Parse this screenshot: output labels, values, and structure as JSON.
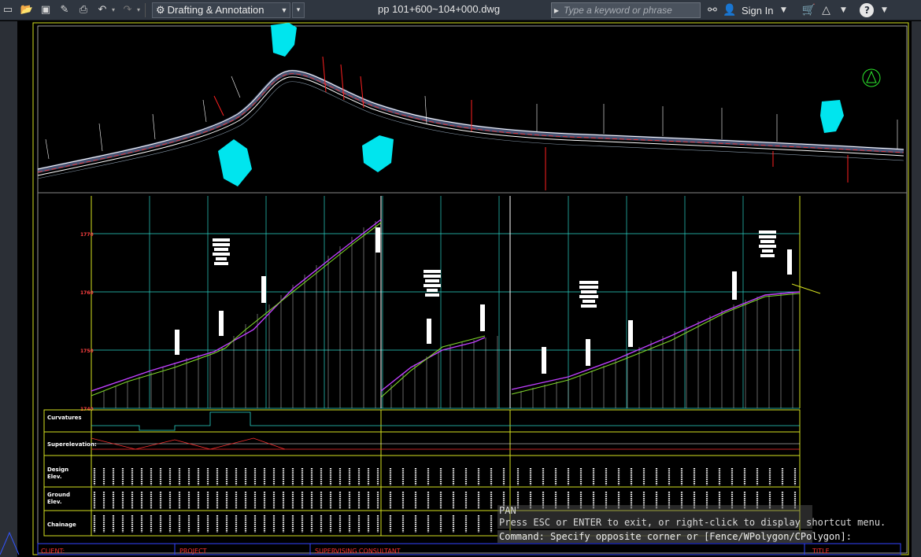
{
  "toolbar": {
    "workspace_label": "Drafting & Annotation",
    "document_title": "pp 101+600~104+000.dwg",
    "search_placeholder": "Type a keyword or phrase",
    "signin_label": "Sign In",
    "help_label": "?"
  },
  "icons": {
    "new": "new-icon",
    "open": "open-icon",
    "save": "save-icon",
    "saveas": "saveas-icon",
    "print": "print-icon",
    "undo": "undo-icon",
    "redo": "redo-icon",
    "gear": "gear-icon",
    "binoculars": "binoculars-icon",
    "user": "user-icon",
    "cart": "cart-icon",
    "a360": "a360-icon"
  },
  "profile": {
    "row_labels": {
      "curvatures": "Curvatures",
      "superelevation": "Superelevation:",
      "design_elev": "Design\nElev.",
      "ground_elev": "Ground\nElev.",
      "chainage": "Chainage"
    }
  },
  "title_block": {
    "client_label": "CLIENT:",
    "project_label": "PROJECT",
    "consultant_label": "SUPERVISING CONSULTANT",
    "title_label": "TITLE"
  },
  "command_line": {
    "history": [
      "PAN",
      "Press ESC or ENTER to exit, or right-click to display shortcut menu."
    ],
    "prompt": "Command: Specify opposite corner or [Fence/WPolygon/CPolygon]:"
  },
  "colors": {
    "background": "#000000",
    "frame_yellow": "#d4e020",
    "grid_cyan": "#2bd4c8",
    "design_line": "#c040ff",
    "ground_line": "#7fd62a",
    "title_bar": "#2f3640",
    "annotation_red": "#ff2020"
  }
}
